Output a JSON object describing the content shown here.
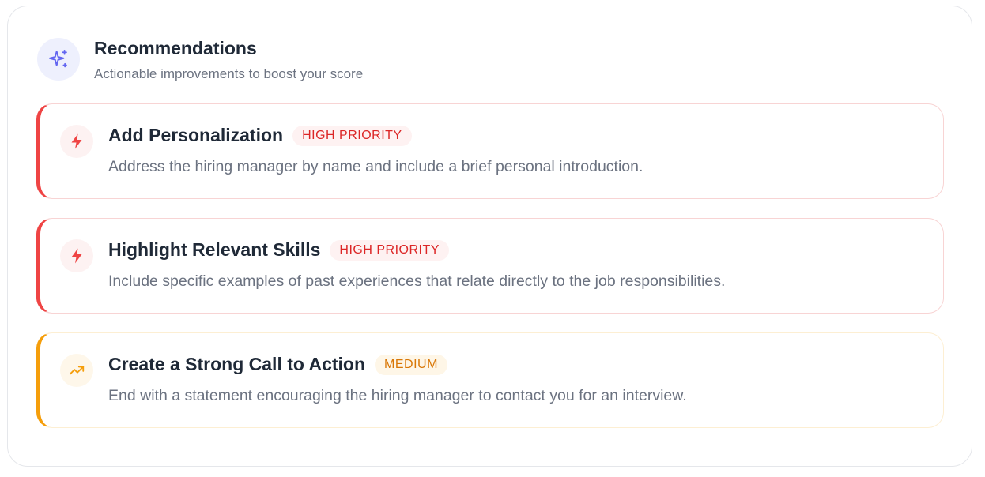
{
  "header": {
    "icon": "sparkles-icon",
    "title": "Recommendations",
    "subtitle": "Actionable improvements to boost your score"
  },
  "colors": {
    "accent": "#6366f1",
    "high": "#ef4444",
    "medium": "#f59e0b"
  },
  "recommendations": [
    {
      "icon": "bolt-icon",
      "title": "Add Personalization",
      "badge": "HIGH PRIORITY",
      "description": "Address the hiring manager by name and include a brief personal introduction."
    },
    {
      "icon": "bolt-icon",
      "title": "Highlight Relevant Skills",
      "badge": "HIGH PRIORITY",
      "description": "Include specific examples of past experiences that relate directly to the job responsibilities."
    },
    {
      "icon": "trending-up-icon",
      "title": "Create a Strong Call to Action",
      "badge": "MEDIUM",
      "description": "End with a statement encouraging the hiring manager to contact you for an interview."
    }
  ]
}
